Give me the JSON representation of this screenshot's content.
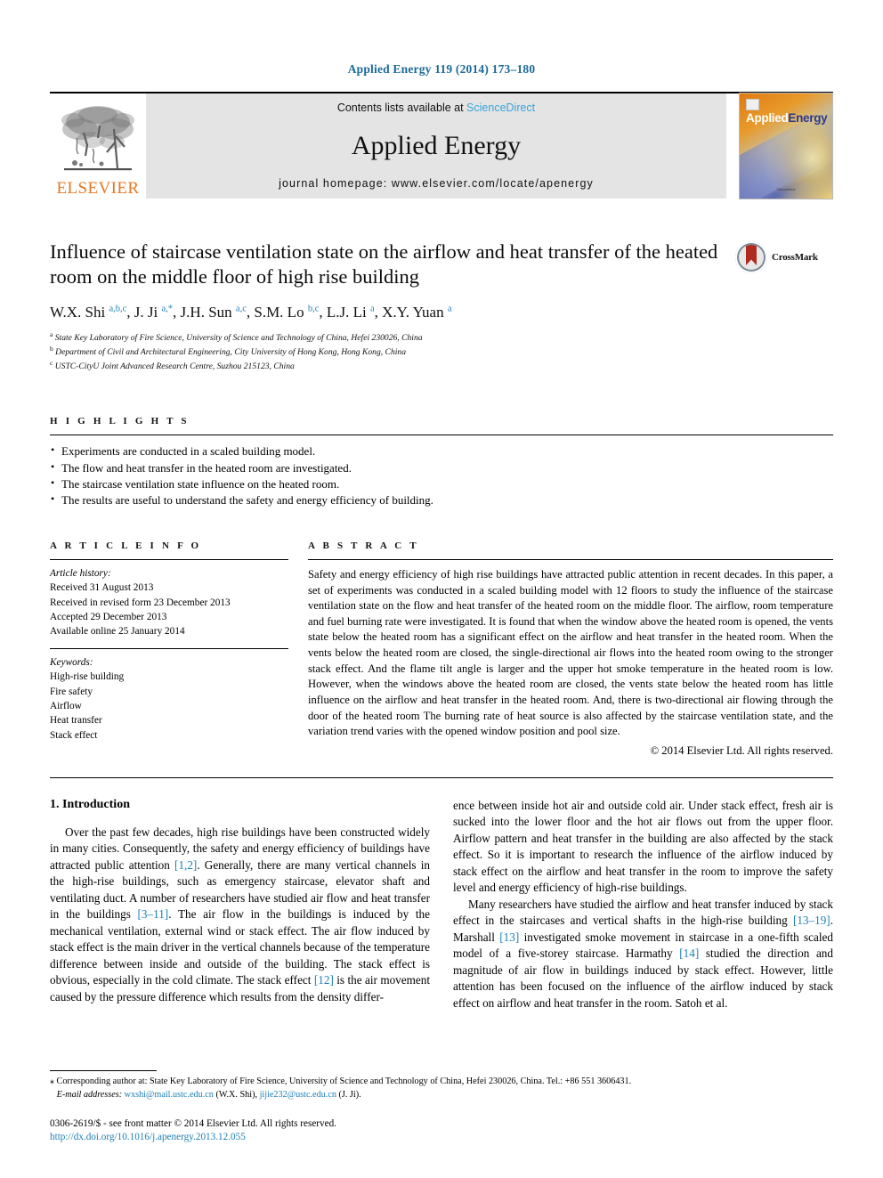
{
  "running_head": "Applied Energy 119 (2014) 173–180",
  "masthead": {
    "publisher": "ELSEVIER",
    "contents_prefix": "Contents lists available at ",
    "contents_link": "ScienceDirect",
    "journal_name": "Applied Energy",
    "homepage_line": "journal homepage: www.elsevier.com/locate/apenergy",
    "cover_title_part1": "Applied",
    "cover_title_part2": "Energy",
    "cover_footer": "ScienceDirect"
  },
  "article": {
    "title": "Influence of staircase ventilation state on the airflow and heat transfer of the heated room on the middle floor of high rise building",
    "crossmark_label": "CrossMark",
    "authors_html": "W.X. Shi <sup>a,b,c</sup>, J. Ji <sup>a,*</sup>, J.H. Sun <sup>a,c</sup>, S.M. Lo <sup>b,c</sup>, L.J. Li <sup>a</sup>, X.Y. Yuan <sup>a</sup>",
    "affiliations": [
      {
        "mark": "a",
        "text": "State Key Laboratory of Fire Science, University of Science and Technology of China, Hefei 230026, China"
      },
      {
        "mark": "b",
        "text": "Department of Civil and Architectural Engineering, City University of Hong Kong, Hong Kong, China"
      },
      {
        "mark": "c",
        "text": "USTC-CityU Joint Advanced Research Centre, Suzhou 215123, China"
      }
    ]
  },
  "highlights": {
    "heading": "H I G H L I G H T S",
    "items": [
      "Experiments are conducted in a scaled building model.",
      "The flow and heat transfer in the heated room are investigated.",
      "The staircase ventilation state influence on the heated room.",
      "The results are useful to understand the safety and energy efficiency of building."
    ]
  },
  "article_info": {
    "heading": "A R T I C L E    I N F O",
    "history_label": "Article history:",
    "history": [
      "Received 31 August 2013",
      "Received in revised form 23 December 2013",
      "Accepted 29 December 2013",
      "Available online 25 January 2014"
    ],
    "keywords_label": "Keywords:",
    "keywords": [
      "High-rise building",
      "Fire safety",
      "Airflow",
      "Heat transfer",
      "Stack effect"
    ]
  },
  "abstract": {
    "heading": "A B S T R A C T",
    "text": "Safety and energy efficiency of high rise buildings have attracted public attention in recent decades. In this paper, a set of experiments was conducted in a scaled building model with 12 floors to study the influence of the staircase ventilation state on the flow and heat transfer of the heated room on the middle floor. The airflow, room temperature and fuel burning rate were investigated. It is found that when the window above the heated room is opened, the vents state below the heated room has a significant effect on the airflow and heat transfer in the heated room. When the vents below the heated room are closed, the single-directional air flows into the heated room owing to the stronger stack effect. And the flame tilt angle is larger and the upper hot smoke temperature in the heated room is low. However, when the windows above the heated room are closed, the vents state below the heated room has little influence on the airflow and heat transfer in the heated room. And, there is two-directional air flowing through the door of the heated room The burning rate of heat source is also affected by the staircase ventilation state, and the variation trend varies with the opened window position and pool size.",
    "copyright": "© 2014 Elsevier Ltd. All rights reserved."
  },
  "introduction": {
    "heading": "1. Introduction",
    "left_para1_html": "Over the past few decades, high rise buildings have been constructed widely in many cities. Consequently, the safety and energy efficiency of buildings have attracted public attention <span class=\"ref\">[1,2]</span>. Generally, there are many vertical channels in the high-rise buildings, such as emergency staircase, elevator shaft and ventilating duct. A number of researchers have studied air flow and heat transfer in the buildings <span class=\"ref\">[3–11]</span>. The air flow in the buildings is induced by the mechanical ventilation, external wind or stack effect. The air flow induced by stack effect is the main driver in the vertical channels because of the temperature difference between inside and outside of the building. The stack effect is obvious, especially in the cold climate. The stack effect <span class=\"ref\">[12]</span> is the air movement caused by the pressure difference which results from the density differ-",
    "right_para1_html": "ence between inside hot air and outside cold air. Under stack effect, fresh air is sucked into the lower floor and the hot air flows out from the upper floor. Airflow pattern and heat transfer in the building are also affected by the stack effect. So it is important to research the influence of the airflow induced by stack effect on the airflow and heat transfer in the room to improve the safety level and energy efficiency of high-rise buildings.",
    "right_para2_html": "Many researchers have studied the airflow and heat transfer induced by stack effect in the staircases and vertical shafts in the high-rise building <span class=\"ref\">[13–19]</span>. Marshall <span class=\"ref\">[13]</span> investigated smoke movement in staircase in a one-fifth scaled model of a five-storey staircase. Harmathy <span class=\"ref\">[14]</span> studied the direction and magnitude of air flow in buildings induced by stack effect. However, little attention has been focused on the influence of the airflow induced by stack effect on airflow and heat transfer in the room. Satoh et al."
  },
  "footnotes": {
    "corresponding_html": "<span class=\"star\">⁎</span> Corresponding author at: State Key Laboratory of Fire Science, University of Science and Technology of China, Hefei 230026, China. Tel.: +86 551 3606431.",
    "email_label": "E-mail addresses:",
    "email1": "wxshi@mail.ustc.edu.cn",
    "email1_who": "(W.X. Shi),",
    "email2": "jijie232@ustc.edu.cn",
    "email2_who": "(J. Ji).",
    "issn_line": "0306-2619/$ - see front matter © 2014 Elsevier Ltd. All rights reserved.",
    "doi_line": "http://dx.doi.org/10.1016/j.apenergy.2013.12.055"
  }
}
